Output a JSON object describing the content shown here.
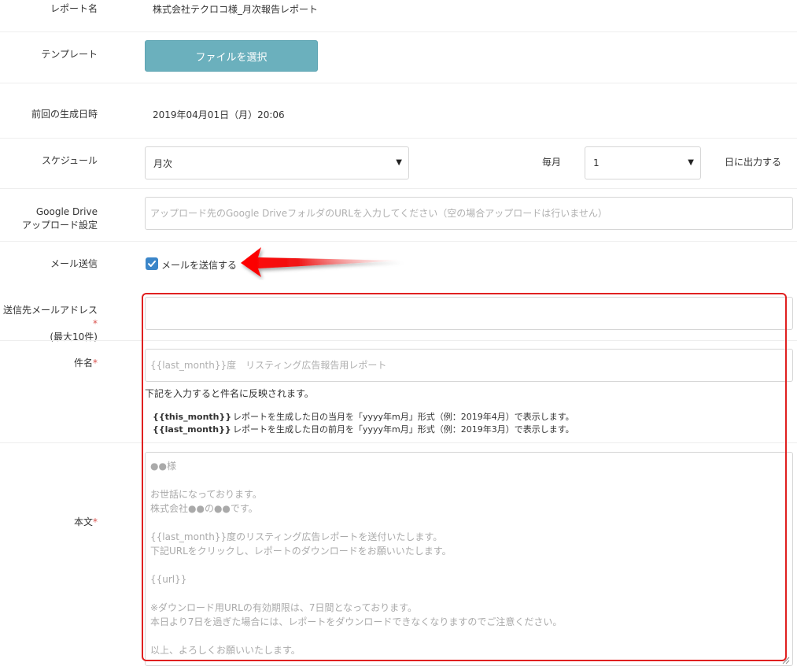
{
  "report_name": {
    "label": "レポート名",
    "value": "株式会社テクロコ様_月次報告レポート"
  },
  "template": {
    "label": "テンプレート",
    "button": "ファイルを選択"
  },
  "last_generated": {
    "label": "前回の生成日時",
    "value": "2019年04月01日（月）20:06"
  },
  "schedule": {
    "label": "スケジュール",
    "frequency": "月次",
    "every_label": "毎月",
    "day": "1",
    "suffix": "日に出力する"
  },
  "google_drive": {
    "label_line1": "Google Drive",
    "label_line2": "アップロード設定",
    "placeholder": "アップロード先のGoogle DriveフォルダのURLを入力してください（空の場合アップロードは行いません）"
  },
  "mail_send": {
    "label": "メール送信",
    "checkbox_label": "メールを送信する",
    "checked": true
  },
  "recipients": {
    "label_line1": "送信先メールアドレス",
    "label_line2": "(最大10件)",
    "required_mark": "*",
    "value": ""
  },
  "subject": {
    "label": "件名",
    "required_mark": "*",
    "placeholder": "{{last_month}}度　リスティング広告報告用レポート",
    "help": "下記を入力すると件名に反映されます。",
    "vars": [
      {
        "name": "{{this_month}}",
        "desc": "レポートを生成した日の当月を「yyyy年m月」形式（例：2019年4月）で表示します。"
      },
      {
        "name": "{{last_month}}",
        "desc": "レポートを生成した日の前月を「yyyy年m月」形式（例：2019年3月）で表示します。"
      }
    ]
  },
  "body": {
    "label": "本文",
    "required_mark": "*",
    "placeholder": "●●様\n\nお世話になっております。\n株式会社●●の●●です。\n\n{{last_month}}度のリスティング広告レポートを送付いたします。\n下記URLをクリックし、レポートのダウンロードをお願いいたします。\n\n{{url}}\n\n※ダウンロード用URLの有効期限は、7日間となっております。\n本日より7日を過ぎた場合には、レポートをダウンロードできなくなりますのでご注意ください。\n\n以上、よろしくお願いいたします。"
  },
  "colors": {
    "button": "#6bb0bd",
    "checkbox": "#3b86c9",
    "highlight": "#e02020",
    "required": "#d9534f"
  }
}
